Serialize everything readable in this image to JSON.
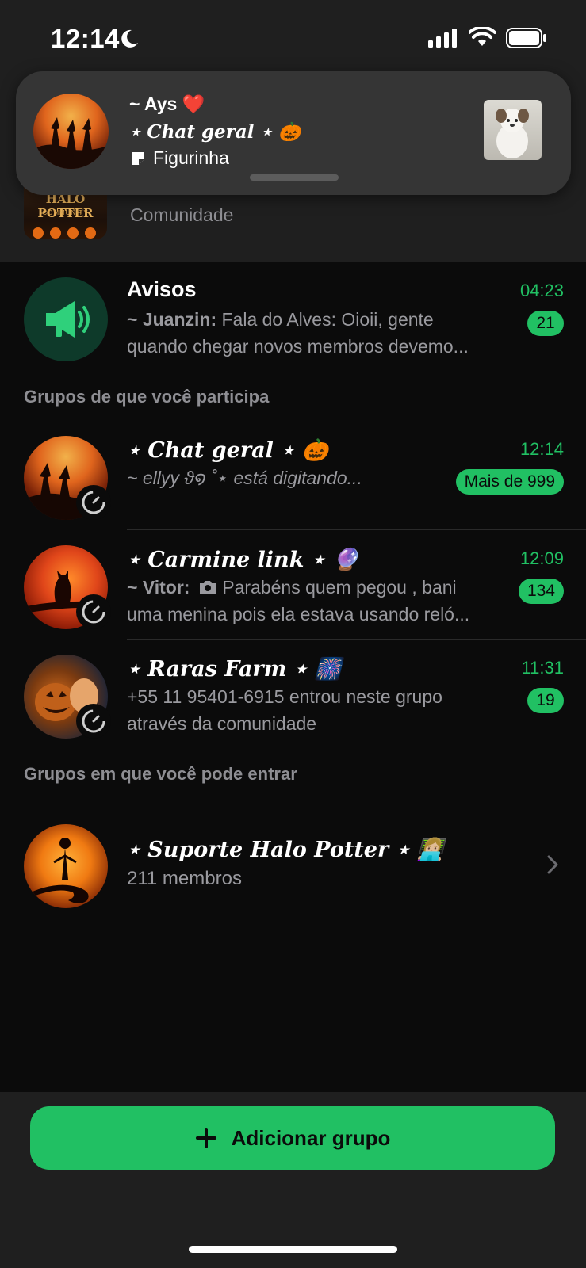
{
  "status_bar": {
    "time": "12:14"
  },
  "notification": {
    "sender": "~ Ays ❤️",
    "group": "⋆ Chat geral ⋆ 🎃",
    "message": "Figurinha"
  },
  "community": {
    "subtitle": "Comunidade",
    "logo_line1": "HALO POTTER",
    "logo_line2": "COMMUNITY"
  },
  "announcements": {
    "title": "Avisos",
    "time": "04:23",
    "unread": "21",
    "sender": "~ Juanzin:",
    "line1": " Fala do Alves:  Oioii, gente",
    "line2": "quando chegar novos membros devemo..."
  },
  "sections": {
    "joined": "Grupos de que você participa",
    "available": "Grupos em que você pode entrar"
  },
  "groups": [
    {
      "title": "⋆ Chat geral ⋆ 🎃",
      "time": "12:14",
      "unread": "Mais de 999",
      "preview": "~ ellyy ϑ໑ ˚⋆ está digitando..."
    },
    {
      "title": "⋆ Carmine link ⋆  🔮",
      "time": "12:09",
      "unread": "134",
      "sender": "~ Vitor:",
      "line1": " Parabéns quem pegou , bani",
      "line2": "uma menina pois ela estava usando reló..."
    },
    {
      "title": "⋆ Raras Farm ⋆  🎆",
      "time": "11:31",
      "unread": "19",
      "line1": "+55 11 95401-6915 entrou neste grupo",
      "line2": "através da comunidade"
    }
  ],
  "available_groups": [
    {
      "title": "⋆ Suporte Halo Potter ⋆  👩🏼‍💻",
      "members": "211 membros"
    }
  ],
  "bottom": {
    "add_group_label": "Adicionar grupo"
  },
  "colors": {
    "accent": "#21c063",
    "background": "#0b0b0b",
    "panel": "#1f1f1f"
  }
}
